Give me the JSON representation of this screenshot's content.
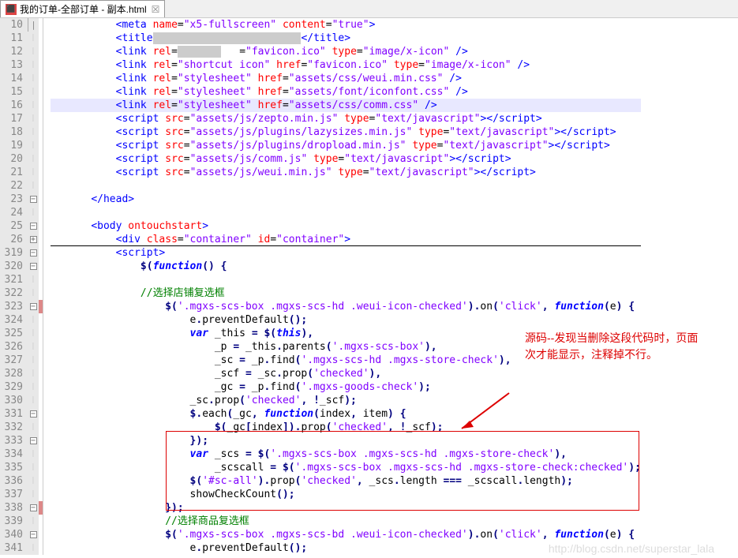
{
  "tab": {
    "title": "我的订单-全部订单 - 副本.html",
    "close": "☒"
  },
  "annotation": {
    "line1": "源码--发现当删除这段代码时，页面",
    "line2": "次才能显示，注释掉不行。"
  },
  "watermark": "http://blog.csdn.net/superstar_lala",
  "lines": [
    {
      "n": "10",
      "fold": "v",
      "cb": "",
      "html": "        <span class='tag'>&lt;meta</span> <span class='attr'>name</span>=<span class='str'>\"x5-fullscreen\"</span> <span class='attr'>content</span>=<span class='str'>\"true\"</span><span class='tag'>&gt;</span>",
      "grey": false
    },
    {
      "n": "11",
      "fold": "",
      "cb": "",
      "html": "        <span class='tag'>&lt;title</span><span class='greyblk'>                        </span><span class='tag'>&lt;/title&gt;</span>"
    },
    {
      "n": "12",
      "fold": "",
      "cb": "",
      "html": "        <span class='tag'>&lt;link</span> <span class='attr'>rel</span>=<span class='greyblk'>       </span><span class='attr'>   </span>=<span class='str'>\"favicon.ico\"</span> <span class='attr'>type</span>=<span class='str'>\"image/x-icon\"</span> <span class='tag'>/&gt;</span>"
    },
    {
      "n": "13",
      "fold": "",
      "cb": "",
      "html": "        <span class='tag'>&lt;link</span> <span class='attr'>rel</span>=<span class='str'>\"shortcut icon\"</span> <span class='attr'>href</span>=<span class='str'>\"favicon.ico\"</span> <span class='attr'>type</span>=<span class='str'>\"image/x-icon\"</span> <span class='tag'>/&gt;</span>"
    },
    {
      "n": "14",
      "fold": "",
      "cb": "",
      "html": "        <span class='tag'>&lt;link</span> <span class='attr'>rel</span>=<span class='str'>\"stylesheet\"</span> <span class='attr'>href</span>=<span class='str'>\"assets/css/weui.min.css\"</span> <span class='tag'>/&gt;</span>"
    },
    {
      "n": "15",
      "fold": "",
      "cb": "",
      "html": "        <span class='tag'>&lt;link</span> <span class='attr'>rel</span>=<span class='str'>\"stylesheet\"</span> <span class='attr'>href</span>=<span class='str'>\"assets/font/iconfont.css\"</span> <span class='tag'>/&gt;</span>"
    },
    {
      "n": "16",
      "fold": "",
      "cb": "",
      "html": "        <span class='tag'>&lt;link</span> <span class='attr'>rel</span>=<span class='str'>\"stylesheet\"</span> <span class='attr'>href</span>=<span class='str'>\"assets/css/comm.css\"</span> <span class='tag'>/&gt;</span>",
      "hl": true
    },
    {
      "n": "17",
      "fold": "",
      "cb": "",
      "html": "        <span class='tag'>&lt;script</span> <span class='attr'>src</span>=<span class='str'>\"assets/js/zepto.min.js\"</span> <span class='attr'>type</span>=<span class='str'>\"text/javascript\"</span><span class='tag'>&gt;&lt;/script&gt;</span>"
    },
    {
      "n": "18",
      "fold": "",
      "cb": "",
      "html": "        <span class='tag'>&lt;script</span> <span class='attr'>src</span>=<span class='str'>\"assets/js/plugins/lazysizes.min.js\"</span> <span class='attr'>type</span>=<span class='str'>\"text/javascript\"</span><span class='tag'>&gt;&lt;/script&gt;</span>"
    },
    {
      "n": "19",
      "fold": "",
      "cb": "",
      "html": "        <span class='tag'>&lt;script</span> <span class='attr'>src</span>=<span class='str'>\"assets/js/plugins/dropload.min.js\"</span> <span class='attr'>type</span>=<span class='str'>\"text/javascript\"</span><span class='tag'>&gt;&lt;/script&gt;</span>"
    },
    {
      "n": "20",
      "fold": "",
      "cb": "",
      "html": "        <span class='tag'>&lt;script</span> <span class='attr'>src</span>=<span class='str'>\"assets/js/comm.js\"</span> <span class='attr'>type</span>=<span class='str'>\"text/javascript\"</span><span class='tag'>&gt;&lt;/script&gt;</span>"
    },
    {
      "n": "21",
      "fold": "",
      "cb": "",
      "html": "        <span class='tag'>&lt;script</span> <span class='attr'>src</span>=<span class='str'>\"assets/js/weui.min.js\"</span> <span class='attr'>type</span>=<span class='str'>\"text/javascript\"</span><span class='tag'>&gt;&lt;/script&gt;</span>"
    },
    {
      "n": "22",
      "fold": "",
      "cb": "",
      "html": ""
    },
    {
      "n": "23",
      "fold": "-",
      "cb": "",
      "html": "    <span class='tag'>&lt;/head&gt;</span>"
    },
    {
      "n": "24",
      "fold": "",
      "cb": "",
      "html": ""
    },
    {
      "n": "25",
      "fold": "-",
      "cb": "",
      "html": "    <span class='tag'>&lt;body</span> <span class='attr'>ontouchstart</span><span class='tag'>&gt;</span>"
    },
    {
      "n": "26",
      "fold": "+",
      "cb": "",
      "html": "        <span class='tag'>&lt;div</span> <span class='attr'>class</span>=<span class='str'>\"container\"</span> <span class='attr'>id</span>=<span class='str'>\"container\"</span><span class='tag'>&gt;</span>",
      "underline": true
    },
    {
      "n": "319",
      "fold": "-",
      "cb": "",
      "html": "        <span class='tag'>&lt;script&gt;</span>"
    },
    {
      "n": "320",
      "fold": "-",
      "cb": "",
      "html": "            <span class='punc'>$(</span><span class='kw'>function</span><span class='punc'>() {</span>"
    },
    {
      "n": "321",
      "fold": "",
      "cb": "",
      "html": ""
    },
    {
      "n": "322",
      "fold": "",
      "cb": "",
      "html": "            <span class='cmt'>//选择店铺复选框</span>"
    },
    {
      "n": "323",
      "fold": "-",
      "cb": "red",
      "html": "                <span class='punc'>$(</span><span class='str'>'.mgxs-scs-box .mgxs-scs-hd .weui-icon-checked'</span><span class='punc'>).</span>on<span class='punc'>(</span><span class='str'>'click'</span><span class='punc'>,</span> <span class='kw'>function</span><span class='punc'>(</span>e<span class='punc'>) {</span>"
    },
    {
      "n": "324",
      "fold": "",
      "cb": "",
      "html": "                    e<span class='punc'>.</span>preventDefault<span class='punc'>();</span>"
    },
    {
      "n": "325",
      "fold": "",
      "cb": "",
      "html": "                    <span class='kw'>var</span> _this <span class='punc'>=</span> <span class='punc'>$(</span><span class='kw'>this</span><span class='punc'>),</span>"
    },
    {
      "n": "326",
      "fold": "",
      "cb": "",
      "html": "                        _p <span class='punc'>=</span> _this<span class='punc'>.</span>parents<span class='punc'>(</span><span class='str'>'.mgxs-scs-box'</span><span class='punc'>),</span>"
    },
    {
      "n": "327",
      "fold": "",
      "cb": "",
      "html": "                        _sc <span class='punc'>=</span> _p<span class='punc'>.</span>find<span class='punc'>(</span><span class='str'>'.mgxs-scs-hd .mgxs-store-check'</span><span class='punc'>),</span>"
    },
    {
      "n": "328",
      "fold": "",
      "cb": "",
      "html": "                        _scf <span class='punc'>=</span> _sc<span class='punc'>.</span>prop<span class='punc'>(</span><span class='str'>'checked'</span><span class='punc'>),</span>"
    },
    {
      "n": "329",
      "fold": "",
      "cb": "",
      "html": "                        _gc <span class='punc'>=</span> _p<span class='punc'>.</span>find<span class='punc'>(</span><span class='str'>'.mgxs-goods-check'</span><span class='punc'>);</span>"
    },
    {
      "n": "330",
      "fold": "",
      "cb": "",
      "html": "                    _sc<span class='punc'>.</span>prop<span class='punc'>(</span><span class='str'>'checked'</span><span class='punc'>, !</span>_scf<span class='punc'>);</span>"
    },
    {
      "n": "331",
      "fold": "-",
      "cb": "",
      "html": "                    <span class='punc'>$.</span>each<span class='punc'>(</span>_gc<span class='punc'>,</span> <span class='kw'>function</span><span class='punc'>(</span>index<span class='punc'>,</span> item<span class='punc'>) {</span>",
      "redbox": "start"
    },
    {
      "n": "332",
      "fold": "",
      "cb": "",
      "html": "                        <span class='punc'>$(</span>_gc<span class='punc'>[</span>index<span class='punc'>]).</span>prop<span class='punc'>(</span><span class='str'>'checked'</span><span class='punc'>, !</span>_scf<span class='punc'>);</span>"
    },
    {
      "n": "333",
      "fold": "-",
      "cb": "",
      "html": "                    <span class='punc'>});</span>"
    },
    {
      "n": "334",
      "fold": "",
      "cb": "",
      "html": "                    <span class='kw'>var</span> _scs <span class='punc'>=</span> <span class='punc'>$(</span><span class='str'>'.mgxs-scs-box .mgxs-scs-hd .mgxs-store-check'</span><span class='punc'>),</span>"
    },
    {
      "n": "335",
      "fold": "",
      "cb": "",
      "html": "                        _scscall <span class='punc'>=</span> <span class='punc'>$(</span><span class='str'>'.mgxs-scs-box .mgxs-scs-hd .mgxs-store-check:checked'</span><span class='punc'>);</span>"
    },
    {
      "n": "336",
      "fold": "",
      "cb": "",
      "html": "                    <span class='punc'>$(</span><span class='str'>'#sc-all'</span><span class='punc'>).</span>prop<span class='punc'>(</span><span class='str'>'checked'</span><span class='punc'>,</span> _scs<span class='punc'>.</span>length <span class='punc'>===</span> _scscall<span class='punc'>.</span>length<span class='punc'>);</span>",
      "redbox": "end"
    },
    {
      "n": "337",
      "fold": "",
      "cb": "",
      "html": "                    showCheckCount<span class='punc'>();</span>"
    },
    {
      "n": "338",
      "fold": "-",
      "cb": "red",
      "html": "                <span class='punc'>});</span>"
    },
    {
      "n": "339",
      "fold": "",
      "cb": "",
      "html": "                <span class='cmt'>//选择商品复选框</span>"
    },
    {
      "n": "340",
      "fold": "-",
      "cb": "",
      "html": "                <span class='punc'>$(</span><span class='str'>'.mgxs-scs-box .mgxs-scs-bd .weui-icon-checked'</span><span class='punc'>).</span>on<span class='punc'>(</span><span class='str'>'click'</span><span class='punc'>,</span> <span class='kw'>function</span><span class='punc'>(</span>e<span class='punc'>) {</span>"
    },
    {
      "n": "341",
      "fold": "",
      "cb": "",
      "html": "                    e<span class='punc'>.</span>preventDefault<span class='punc'>();</span>"
    }
  ]
}
